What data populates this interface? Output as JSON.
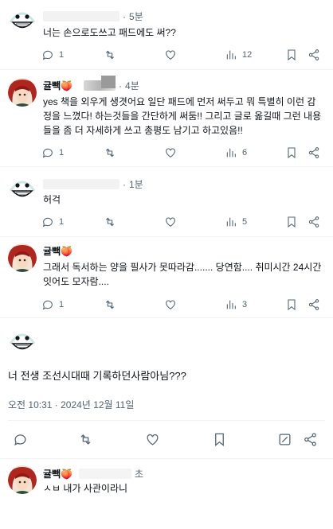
{
  "reply1": {
    "time": "5분",
    "text": "너는 손으로도쓰고 패드에도 써??",
    "reply_count": "1",
    "like_count": "",
    "view_count": "12"
  },
  "reply2": {
    "name": "귤빽🍑",
    "time": "4분",
    "text": "yes 책을 외우게 생겻어요 일단 패드에 먼저 써두고 뭐 특별히 이런 감정을 느꼈다! 하는것들을 간단하게 써둠!! 그리고 글로 옮길때 그런 내용들을 좀 더 자세하게 쓰고 총평도 남기고 하고있음!!",
    "reply_count": "1",
    "view_count": "6"
  },
  "reply3": {
    "time": "1분",
    "text": "허걱",
    "reply_count": "1",
    "view_count": "5"
  },
  "reply4": {
    "name": "귤빽🍑",
    "text": "그래서 독서하는 양을 필사가 못따라감....... 당연함.... 취미시간 24시간 잇어도 모자람....",
    "reply_count": "1",
    "view_count": "3"
  },
  "focus": {
    "text": "너 전생 조선시대때 기록하던사람아님???",
    "timestamp": "오전 10:31 · 2024년 12월 11일"
  },
  "reply5": {
    "name": "귤빽🍑",
    "time": "초",
    "text": "ㅅㅂ 내가 사관이라니"
  },
  "icons": [
    "reply-icon",
    "retweet-icon",
    "like-icon",
    "views-icon",
    "bookmark-icon",
    "share-icon",
    "edit-icon"
  ],
  "colors": {
    "text": "#0f1419",
    "secondary": "#536471",
    "divider": "#eff3f4"
  }
}
